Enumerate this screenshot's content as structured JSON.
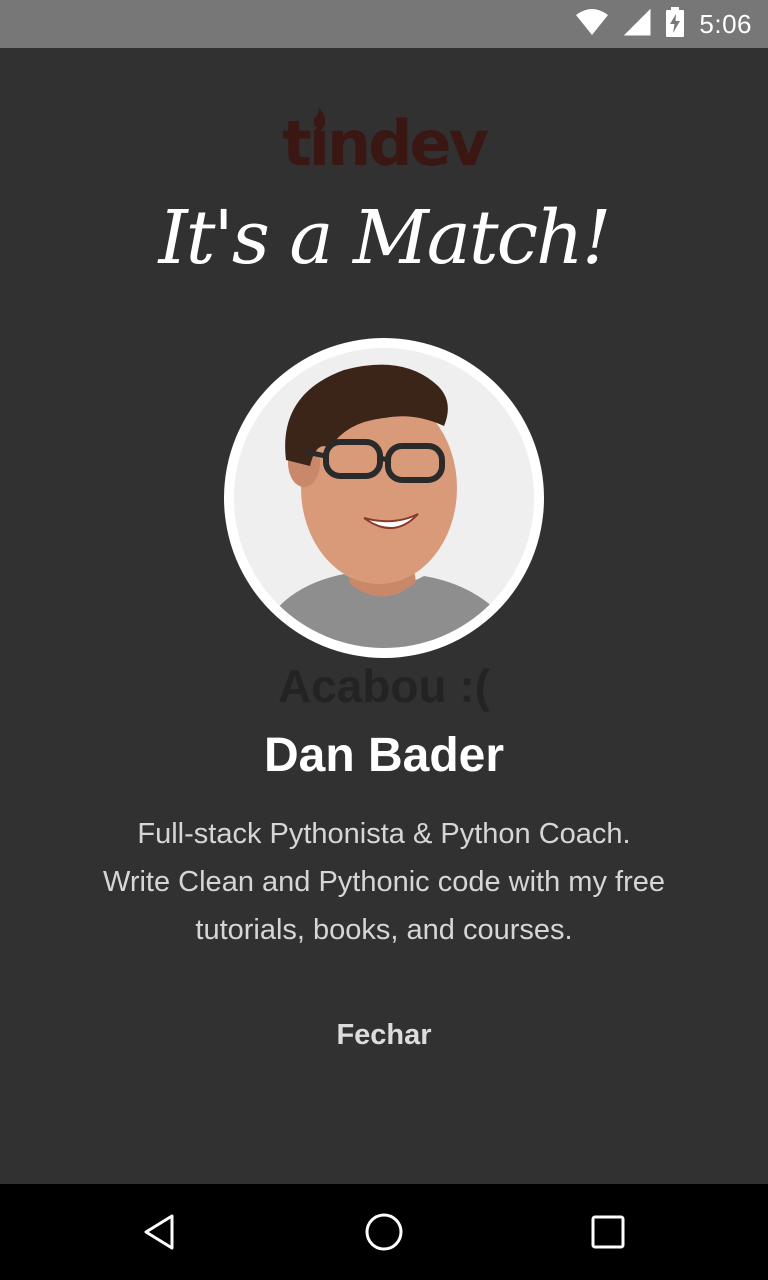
{
  "status_bar": {
    "time": "5:06",
    "icons": [
      "wifi-icon",
      "signal-icon",
      "battery-charging-icon"
    ],
    "background": "#777777"
  },
  "logo": {
    "text": "tindev",
    "color": "#3b1713"
  },
  "match": {
    "title": "It's a Match!"
  },
  "profile": {
    "avatar": "avatar-photo",
    "empty_text": "Acabou :(",
    "name": "Dan Bader",
    "bio_lines": [
      "Full-stack Pythonista & Python Coach.",
      "Write Clean and Pythonic code with my free",
      "tutorials, books, and courses."
    ]
  },
  "actions": {
    "close_label": "Fechar"
  },
  "nav_bar": {
    "buttons": [
      "back-icon",
      "home-icon",
      "recents-icon"
    ]
  },
  "colors": {
    "background": "#313131",
    "text": "#ffffff",
    "muted_text": "#d6d6d6"
  }
}
